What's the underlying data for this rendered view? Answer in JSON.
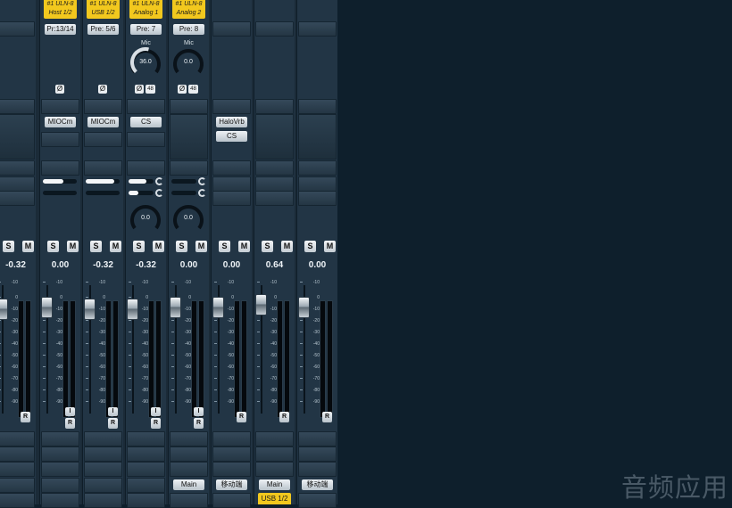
{
  "strips": [
    {
      "id": "s0",
      "input": "",
      "preamp": "",
      "mic_label": "",
      "gain_knob": "",
      "phase": false,
      "p48": false,
      "plugins": [],
      "sends": [],
      "bottom_knob": "",
      "gain": "-0.32",
      "fader": 0.42,
      "has_i": false,
      "output": "",
      "assign": ""
    },
    {
      "id": "s1",
      "input": "#1 ULN-8\nHost 1/2",
      "preamp": "Pr:13/14",
      "mic_label": "",
      "gain_knob": "",
      "phase": true,
      "p48": false,
      "plugins": [
        "MIOCm"
      ],
      "sends": [
        0.6,
        0.0
      ],
      "bottom_knob": "",
      "gain": "0.00",
      "fader": 0.45,
      "has_i": true,
      "output": "",
      "assign": ""
    },
    {
      "id": "s2",
      "input": "#1 ULN-8\nUSB 1/2",
      "preamp": "Pre: 5/6",
      "mic_label": "",
      "gain_knob": "",
      "phase": true,
      "p48": false,
      "plugins": [
        "MIOCm"
      ],
      "sends": [
        0.85,
        0.0
      ],
      "bottom_knob": "",
      "gain": "-0.32",
      "fader": 0.42,
      "has_i": true,
      "output": "",
      "assign": ""
    },
    {
      "id": "s3",
      "input": "#1 ULN-8\nAnalog 1",
      "preamp": "Pre: 7",
      "mic_label": "Mic",
      "gain_knob": "36.0",
      "phase": true,
      "p48": true,
      "plugins": [
        "CS"
      ],
      "sends": [
        0.7,
        0.4
      ],
      "bottom_knob": "0.0",
      "gain": "-0.32",
      "fader": 0.42,
      "has_i": true,
      "output": "",
      "assign": ""
    },
    {
      "id": "s4",
      "input": "#1 ULN-8\nAnalog 2",
      "preamp": "Pre: 8",
      "mic_label": "Mic",
      "gain_knob": "0.0",
      "phase": true,
      "p48": true,
      "plugins": [],
      "sends": [
        0.0,
        0.0
      ],
      "bottom_knob": "0.0",
      "gain": "0.00",
      "fader": 0.45,
      "has_i": true,
      "output": "Main",
      "assign": ""
    },
    {
      "id": "s5",
      "input": "",
      "preamp": "",
      "mic_label": "",
      "gain_knob": "",
      "phase": false,
      "p48": false,
      "plugins": [
        "HaloVrb",
        "CS"
      ],
      "sends": [],
      "bottom_knob": "",
      "gain": "0.00",
      "fader": 0.45,
      "has_i": false,
      "output": "移动端",
      "assign": ""
    },
    {
      "id": "s6",
      "input": "",
      "preamp": "",
      "mic_label": "",
      "gain_knob": "",
      "phase": false,
      "p48": false,
      "plugins": [],
      "sends": [],
      "bottom_knob": "",
      "gain": "0.64",
      "fader": 0.5,
      "has_i": false,
      "output": "Main",
      "assign": "USB 1/2"
    },
    {
      "id": "s7",
      "input": "",
      "preamp": "",
      "mic_label": "",
      "gain_knob": "",
      "phase": false,
      "p48": false,
      "plugins": [],
      "sends": [],
      "bottom_knob": "",
      "gain": "0.00",
      "fader": 0.45,
      "has_i": false,
      "output": "移动端",
      "assign": ""
    }
  ],
  "labels": {
    "solo": "S",
    "mute": "M",
    "phase": "Ø",
    "p48": "48",
    "rec": "R",
    "input_btn": "I"
  },
  "scale_marks": [
    "-10",
    "0",
    "-10",
    "-20",
    "-30",
    "-40",
    "-50",
    "-60",
    "-70",
    "-80",
    "-90"
  ],
  "watermark": "音频应用",
  "colors": {
    "input_tag": "#f2c81e",
    "background": "#0e1f2c",
    "strip": "#223545"
  }
}
